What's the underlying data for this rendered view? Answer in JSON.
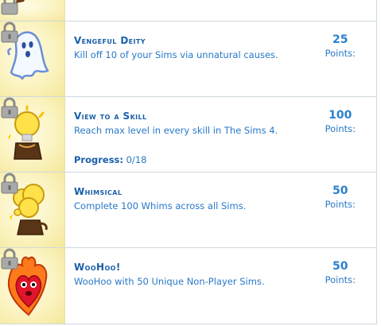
{
  "achievements": [
    {
      "title": "",
      "description": "",
      "points": "",
      "points_label": ""
    },
    {
      "title": "Vengeful Deity",
      "description": "Kill off 10 of your Sims via unnatural causes.",
      "points": "25",
      "points_label": "Points:",
      "icon": "ghost-icon",
      "locked": true
    },
    {
      "title": "View to a Skill",
      "description": "Reach max level in every skill in The Sims 4.",
      "points": "100",
      "points_label": "Points:",
      "progress_label": "Progress:",
      "progress_value": "0/18",
      "icon": "lightbulb-trophy-icon",
      "locked": true
    },
    {
      "title": "Whimsical",
      "description": "Complete 100 Whims across all Sims.",
      "points": "50",
      "points_label": "Points:",
      "icon": "thought-bubble-trophy-icon",
      "locked": true
    },
    {
      "title": "WooHoo!",
      "description": "WooHoo with 50 Unique Non-Player Sims.",
      "points": "50",
      "points_label": "Points:",
      "icon": "flaming-heart-icon",
      "locked": true
    }
  ],
  "colors": {
    "title": "#1a5fa8",
    "text": "#2878c8",
    "icon_bg": "#fbf3c0",
    "divider": "#cfd8e0"
  }
}
